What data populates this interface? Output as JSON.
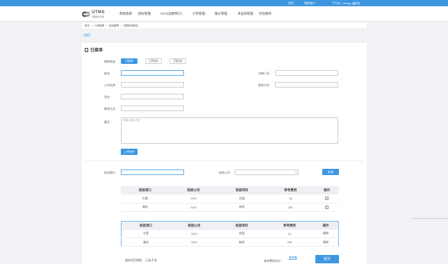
{
  "topbar": {
    "links": [
      "首页",
      "我的账户",
      "下午好，zhang_lq",
      "[退出]"
    ]
  },
  "header": {
    "logo_name": "UTMS",
    "logo_sub": "优路易达运输",
    "nav": [
      {
        "label": "帮助指南",
        "caret": false
      },
      {
        "label": "招标管理",
        "caret": true
      },
      {
        "label": "COA(远期预订)",
        "caret": true
      },
      {
        "label": "订单管理",
        "caret": true
      },
      {
        "label": "报价管理",
        "caret": true
      },
      {
        "label": "承运商管理",
        "caret": false
      },
      {
        "label": "综合服务",
        "caret": true
      }
    ]
  },
  "breadcrumb": [
    "首页",
    "/",
    "订单管理",
    "/",
    "检验管理",
    "/",
    "查看检验报告"
  ],
  "back_label": "返回",
  "panel": {
    "title": "已接单",
    "status_label": "接单状态",
    "status_tabs": [
      "已接单",
      "已完成0",
      "已取消1"
    ],
    "fields": {
      "ship_name": "船名",
      "company": "公司名称",
      "cargo": "货名",
      "contact": "联系方式",
      "assignee": "派单人员",
      "contact2": "联系方式",
      "remark": "备注",
      "remark_placeholder": "请输入备注内容"
    },
    "upload_label": "上传附件",
    "port_label": "检验港口",
    "company_select_label": "检验公司",
    "add_label": "新增",
    "table1": {
      "headers": [
        "检验港口",
        "检验公司",
        "检验项目",
        "参考费用",
        "操作"
      ],
      "rows": [
        [
          "东营",
          "SGS",
          "验报",
          "15",
          "✓"
        ],
        [
          "潍坊",
          "SGS",
          "取样",
          "200",
          "✓"
        ]
      ]
    },
    "table2": {
      "headers": [
        "检验港口",
        "检验公司",
        "检验项目",
        "参考费用",
        "操作"
      ],
      "rows": [
        [
          "东营",
          "SGS",
          "验报",
          "15",
          "删除"
        ],
        [
          "潍坊",
          "SGS",
          "取样",
          "200",
          "删除"
        ]
      ]
    },
    "selected_prefix": "服务项目明细",
    "selected_mid": "已选",
    "selected_count": "2",
    "selected_suffix": "条",
    "total_label": "参考费用合计：",
    "total_value": "215",
    "submit_label": "提交"
  }
}
